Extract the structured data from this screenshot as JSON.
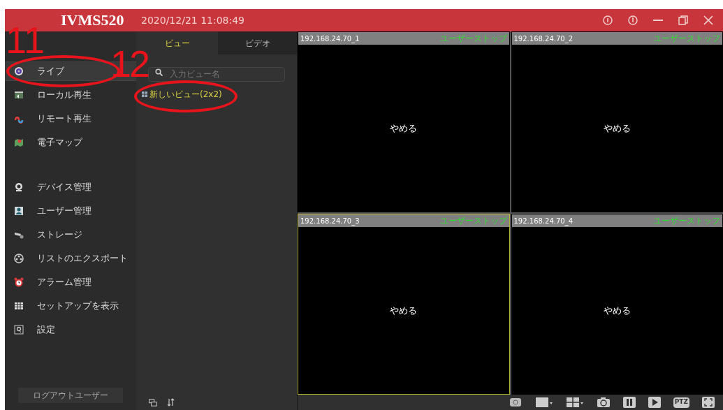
{
  "header": {
    "title": "IVMS520",
    "datetime": "2020/12/21 11:08:49"
  },
  "sidebar": {
    "items": [
      {
        "label": "ライブ",
        "selected": true
      },
      {
        "label": "ローカル再生",
        "selected": false
      },
      {
        "label": "リモート再生",
        "selected": false
      },
      {
        "label": "電子マップ",
        "selected": false
      },
      {
        "label": "デバイス管理",
        "selected": false
      },
      {
        "label": "ユーザー管理",
        "selected": false
      },
      {
        "label": "ストレージ",
        "selected": false
      },
      {
        "label": "リストのエクスポート",
        "selected": false
      },
      {
        "label": "アラーム管理",
        "selected": false
      },
      {
        "label": "セットアップを表示",
        "selected": false
      },
      {
        "label": "設定",
        "selected": false
      }
    ],
    "logout_button": "ログアウトユーザー"
  },
  "view_panel": {
    "tabs": [
      {
        "label": "ビュー",
        "selected": true
      },
      {
        "label": "ビデオ",
        "selected": false
      }
    ],
    "search": {
      "placeholder": "入力ビュー名"
    },
    "views": [
      {
        "label": "新しいビュー(2x2)"
      }
    ]
  },
  "video_panes": [
    {
      "label": "192.168.24.70_1",
      "status": "ユーザーストップ",
      "message": "やめる",
      "selected": false
    },
    {
      "label": "192.168.24.70_2",
      "status": "ユーザーストッフ",
      "message": "やめる",
      "selected": false
    },
    {
      "label": "192.168.24.70_3",
      "status": "ユーザーストップ",
      "message": "やめる",
      "selected": true
    },
    {
      "label": "192.168.24.70_4",
      "status": "ユーザーストッフ",
      "message": "やめる",
      "selected": false
    }
  ],
  "toolbar": {
    "ptz_label": "PTZ"
  },
  "annotations": [
    {
      "label": "11"
    },
    {
      "label": "12"
    }
  ]
}
